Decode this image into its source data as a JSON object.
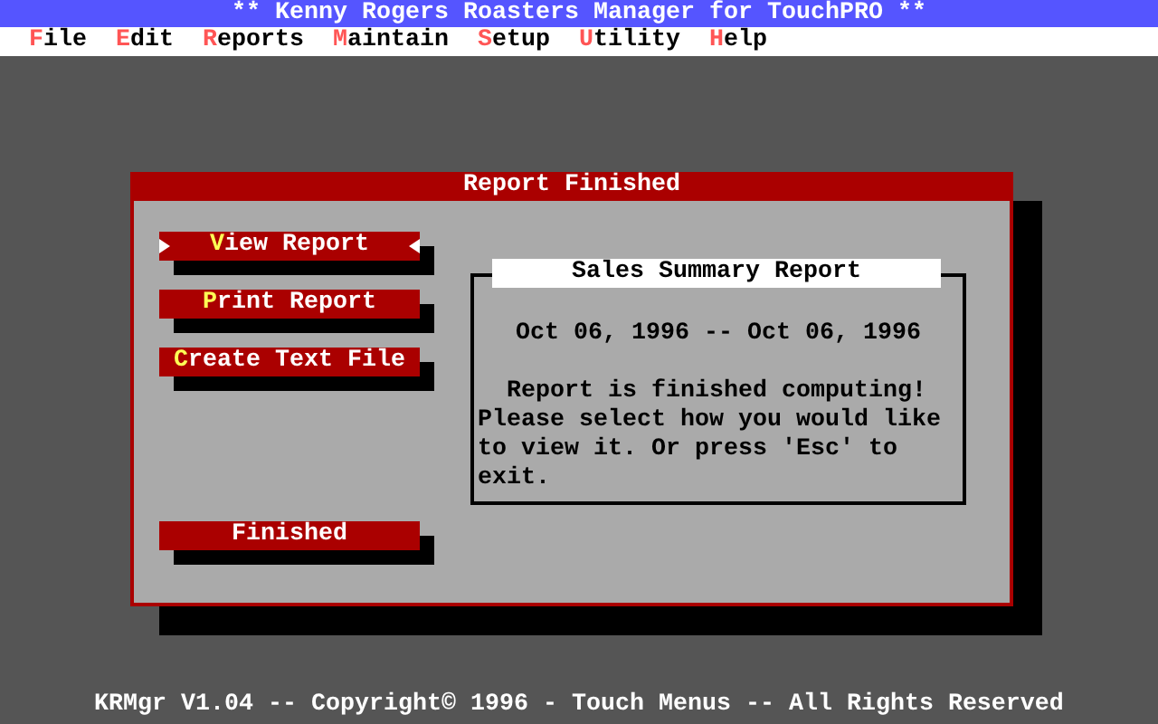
{
  "window": {
    "title": "** Kenny Rogers Roasters Manager for TouchPRO **"
  },
  "menu": [
    {
      "hotkey": "F",
      "rest": "ile"
    },
    {
      "hotkey": "E",
      "rest": "dit"
    },
    {
      "hotkey": "R",
      "rest": "eports"
    },
    {
      "hotkey": "M",
      "rest": "aintain"
    },
    {
      "hotkey": "S",
      "rest": "etup"
    },
    {
      "hotkey": "U",
      "rest": "tility"
    },
    {
      "hotkey": "H",
      "rest": "elp"
    }
  ],
  "dialog": {
    "title": "Report Finished",
    "buttons": [
      {
        "hotkey": "V",
        "rest": "iew Report",
        "selected": true
      },
      {
        "hotkey": "P",
        "rest": "rint Report",
        "selected": false
      },
      {
        "hotkey": "C",
        "rest": "reate Text File",
        "selected": false
      },
      {
        "rest": "Finished",
        "selected": false
      }
    ],
    "summary": {
      "title": "Sales Summary Report",
      "date_range": "Oct 06, 1996 -- Oct 06, 1996",
      "message": "  Report is finished computing! Please select how you would like to view it. Or press 'Esc' to exit."
    }
  },
  "status_bar": "KRMgr V1.04 -- Copyright© 1996 - Touch Menus -- All Rights Reserved"
}
